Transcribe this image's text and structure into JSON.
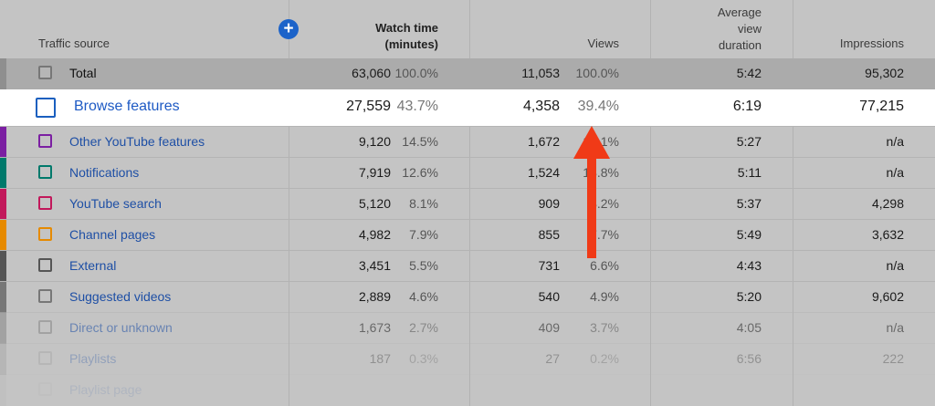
{
  "header": {
    "traffic_source": "Traffic source",
    "watch_time": [
      "Watch time",
      "(minutes)"
    ],
    "views": "Views",
    "avg_view_duration": [
      "Average",
      "view",
      "duration"
    ],
    "impressions": "Impressions"
  },
  "total": {
    "label": "Total",
    "watch_time": "63,060",
    "watch_time_pct": "100.0%",
    "views": "11,053",
    "views_pct": "100.0%",
    "duration": "5:42",
    "impressions": "95,302"
  },
  "rows": [
    {
      "label": "Browse features",
      "watch_time": "27,559",
      "watch_time_pct": "43.7%",
      "views": "4,358",
      "views_pct": "39.4%",
      "duration": "6:19",
      "impressions": "77,215",
      "color": "#1a5fbf"
    },
    {
      "label": "Other YouTube features",
      "watch_time": "9,120",
      "watch_time_pct": "14.5%",
      "views": "1,672",
      "views_pct": "15.1%",
      "duration": "5:27",
      "impressions": "n/a",
      "color": "#7b1fa2"
    },
    {
      "label": "Notifications",
      "watch_time": "7,919",
      "watch_time_pct": "12.6%",
      "views": "1,524",
      "views_pct": "13.8%",
      "duration": "5:11",
      "impressions": "n/a",
      "color": "#00796b"
    },
    {
      "label": "YouTube search",
      "watch_time": "5,120",
      "watch_time_pct": "8.1%",
      "views": "909",
      "views_pct": "8.2%",
      "duration": "5:37",
      "impressions": "4,298",
      "color": "#c2185b"
    },
    {
      "label": "Channel pages",
      "watch_time": "4,982",
      "watch_time_pct": "7.9%",
      "views": "855",
      "views_pct": "7.7%",
      "duration": "5:49",
      "impressions": "3,632",
      "color": "#e68a00"
    },
    {
      "label": "External",
      "watch_time": "3,451",
      "watch_time_pct": "5.5%",
      "views": "731",
      "views_pct": "6.6%",
      "duration": "4:43",
      "impressions": "n/a",
      "color": "#555555"
    },
    {
      "label": "Suggested videos",
      "watch_time": "2,889",
      "watch_time_pct": "4.6%",
      "views": "540",
      "views_pct": "4.9%",
      "duration": "5:20",
      "impressions": "9,602",
      "color": "#777777"
    },
    {
      "label": "Direct or unknown",
      "watch_time": "1,673",
      "watch_time_pct": "2.7%",
      "views": "409",
      "views_pct": "3.7%",
      "duration": "4:05",
      "impressions": "n/a",
      "color": "#888888"
    },
    {
      "label": "Playlists",
      "watch_time": "187",
      "watch_time_pct": "0.3%",
      "views": "27",
      "views_pct": "0.2%",
      "duration": "6:56",
      "impressions": "222",
      "color": "#999999"
    },
    {
      "label": "Playlist page",
      "watch_time": "",
      "watch_time_pct": "",
      "views": "",
      "views_pct": "",
      "duration": "",
      "impressions": "",
      "color": "#aaaaaa"
    }
  ],
  "colors": {
    "arrow": "#f03a17",
    "link": "#1e4fa5",
    "add_button": "#1c63c9"
  }
}
